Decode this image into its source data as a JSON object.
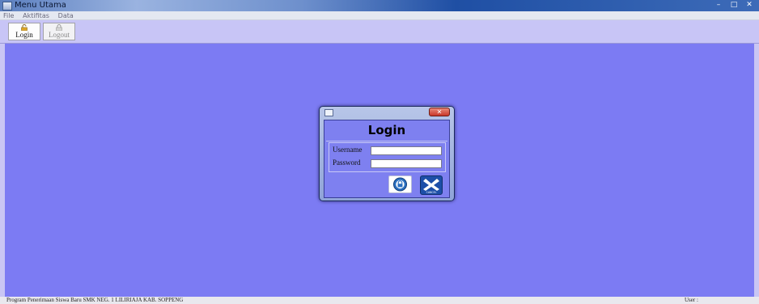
{
  "window": {
    "title": "Menu Utama",
    "controls": {
      "minimize": "–",
      "maximize": "□",
      "close": "✕"
    }
  },
  "menubar": {
    "items": [
      "File",
      "Aktifitas",
      "Data"
    ]
  },
  "toolbar": {
    "login_label": "Login",
    "logout_label": "Logout",
    "login_icon": "lock-open-icon",
    "logout_icon": "lock-icon"
  },
  "login_dialog": {
    "heading": "Login",
    "close": "✕",
    "username_label": "Username",
    "password_label": "Password",
    "username_value": "",
    "password_value": "",
    "login_button_icon": "padlock-icon",
    "cancel_button_icon": "cancel-x-icon",
    "cancel_button_caption": "CANCEL"
  },
  "statusbar": {
    "left_text": "Program Penerimaan Siswa Baru SMK NEG. 1 LILIRIAJA KAB. SOPPENG",
    "right_text": "User :"
  },
  "colors": {
    "main_background": "#7c7bf3",
    "toolbar_background": "#c8c5f6",
    "dialog_body": "#7e80f0"
  }
}
